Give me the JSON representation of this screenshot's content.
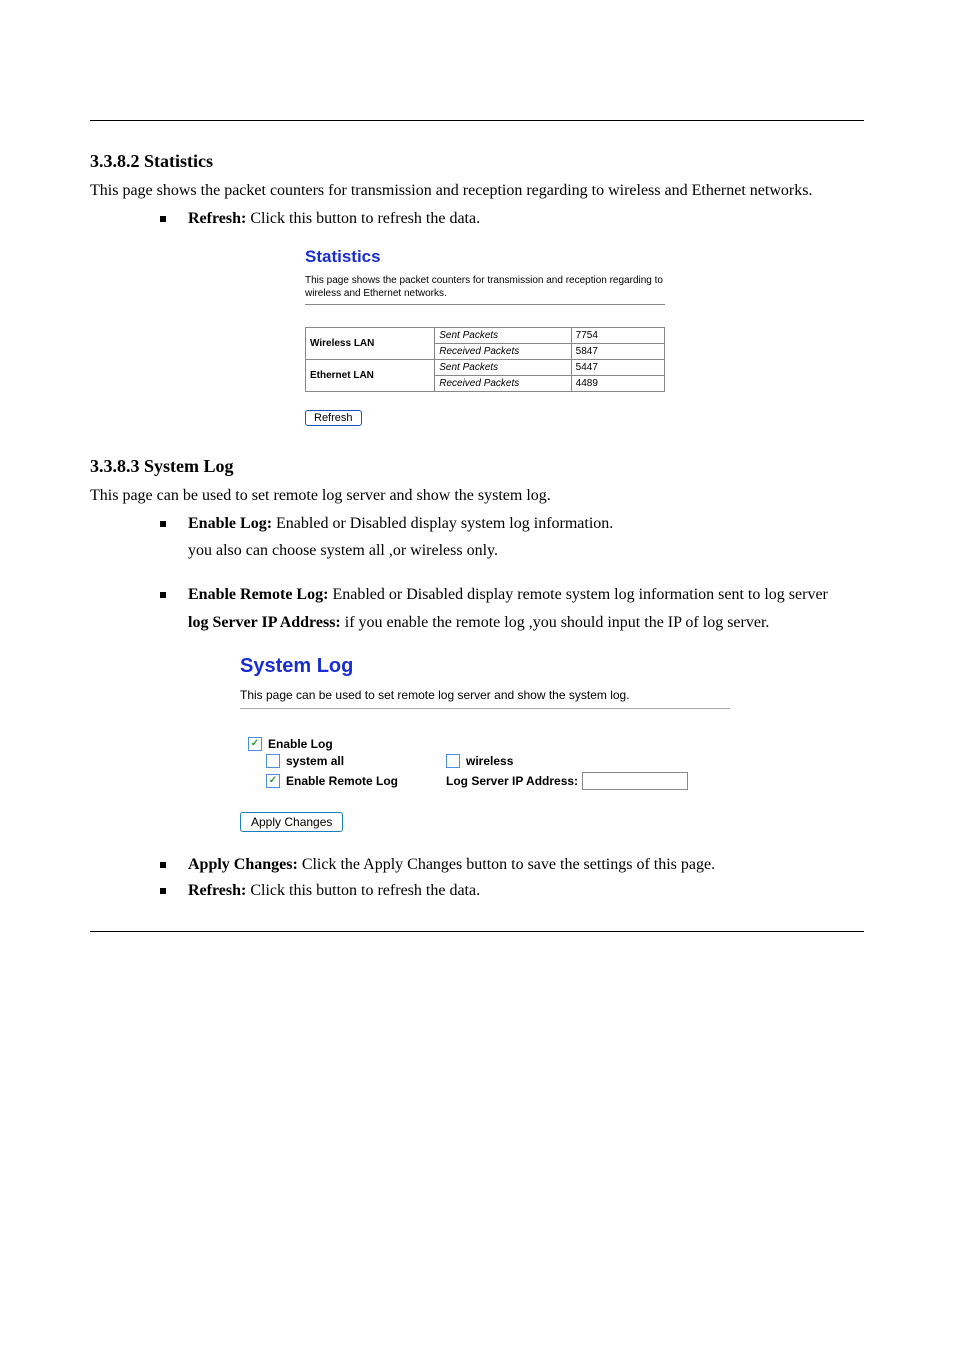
{
  "sections": {
    "statistics": {
      "heading": "3.3.8.2 Statistics",
      "intro": "This page shows the packet counters for transmission and reception regarding to wireless and Ethernet networks.",
      "refresh_bullet_term": "Refresh: ",
      "refresh_bullet_text": "Click this button to refresh the data."
    },
    "statistics_shot": {
      "title": "Statistics",
      "desc": "This page shows the packet counters for transmission and reception regarding to wireless and Ethernet networks.",
      "rows": {
        "wlan_label": "Wireless LAN",
        "elan_label": "Ethernet LAN",
        "sent_label": "Sent Packets",
        "recv_label": "Received Packets",
        "wlan_sent": "7754",
        "wlan_recv": "5847",
        "elan_sent": "5447",
        "elan_recv": "4489"
      },
      "refresh_btn": "Refresh"
    },
    "syslog": {
      "heading": "3.3.8.3 System Log",
      "intro": "This page can be used to set remote log server and show the system log.",
      "enable_bullet_term": "Enable Log: ",
      "enable_bullet_text": "Enabled or Disabled display system log information.",
      "after_enable_para": "you also can choose system all ,or wireless only.",
      "remote_bullet_term": "Enable Remote Log: ",
      "remote_bullet_text": "Enabled or Disabled display remote system log information sent to log server",
      "server_para_term": "log Server IP Address: ",
      "server_para_text": "if you enable the remote log ,you should input the IP of log server.",
      "apply_bullet_term": "Apply Changes: ",
      "apply_bullet_text": "Click the Apply Changes button to save the settings of this page.",
      "refresh_bullet_term": "Refresh: ",
      "refresh_bullet_text": "Click this button to refresh the data."
    },
    "syslog_shot": {
      "title": "System Log",
      "desc": "This page can be used to set remote log server and show the system log.",
      "enable_log": "Enable Log",
      "system_all": "system all",
      "wireless": "wireless",
      "enable_remote": "Enable Remote Log",
      "server_label": "Log Server IP Address:",
      "apply_btn": "Apply Changes"
    }
  }
}
